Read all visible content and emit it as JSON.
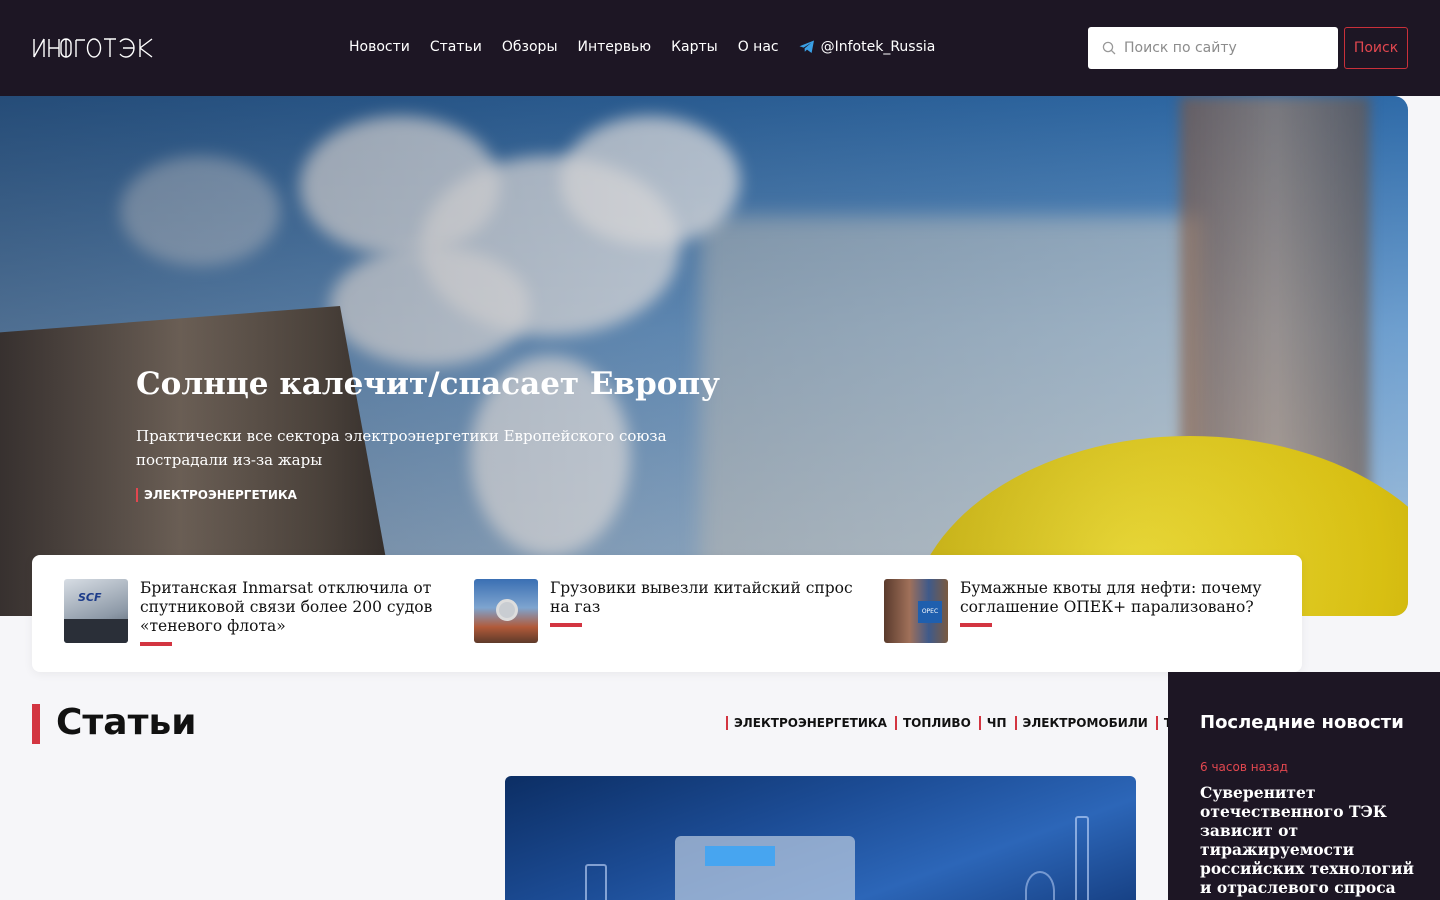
{
  "header": {
    "logo": "ИНФОТЭК",
    "nav": [
      {
        "label": "Новости"
      },
      {
        "label": "Статьи"
      },
      {
        "label": "Обзоры"
      },
      {
        "label": "Интервью"
      },
      {
        "label": "Карты"
      },
      {
        "label": "О нас"
      }
    ],
    "telegram": "@Infotek_Russia",
    "search_placeholder": "Поиск по сайту",
    "search_button": "Поиск"
  },
  "hero": {
    "title": "Солнце калечит/спасает Европу",
    "subtitle": "Практически все сектора электроэнергетики Европейского союза пострадали из-за жары",
    "tag": "ЭЛЕКТРОЭНЕРГЕТИКА"
  },
  "featured": [
    {
      "title": "Британская Inmarsat отключила от спутниковой связи более 200 судов «теневого флота»",
      "thumb_text": "SCF"
    },
    {
      "title": "Грузовики вывезли китайский спрос на газ",
      "thumb_text": ""
    },
    {
      "title": "Бумажные квоты для нефти: почему соглашение ОПЕК+ парализовано?",
      "thumb_text": "OPEC"
    }
  ],
  "articles": {
    "title": "Статьи",
    "categories": [
      "ЭЛЕКТРОЭНЕРГЕТИКА",
      "ТОПЛИВО",
      "ЧП",
      "ЭЛЕКТРОМОБИЛИ",
      "ТОП"
    ]
  },
  "sidebar": {
    "title": "Последние новости",
    "time": "6 часов назад",
    "news": "Суверенитет отечественного ТЭК зависит от тиражируемости российских технологий и отраслевого спроса"
  },
  "colors": {
    "header_bg": "#1d1624",
    "accent": "#d33541"
  }
}
